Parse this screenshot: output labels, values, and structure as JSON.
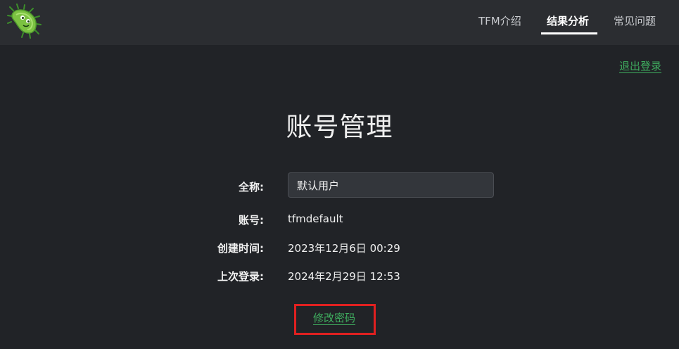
{
  "nav": {
    "logo_icon": "bacteria-icon",
    "items": [
      {
        "label": "TFM介绍",
        "active": false
      },
      {
        "label": "结果分析",
        "active": true
      },
      {
        "label": "常见问题",
        "active": false
      }
    ]
  },
  "logout_label": "退出登录",
  "page_title": "账号管理",
  "fields": {
    "fullname_label": "全称:",
    "fullname_value": "默认用户",
    "account_label": "账号:",
    "account_value": "tfmdefault",
    "created_label": "创建时间:",
    "created_value": "2023年12月6日 00:29",
    "last_login_label": "上次登录:",
    "last_login_value": "2024年2月29日 12:53"
  },
  "change_password_label": "修改密码",
  "colors": {
    "background": "#212327",
    "navbar": "#2b2d31",
    "link_green": "#3fae5f",
    "highlight_red": "#e02020"
  }
}
